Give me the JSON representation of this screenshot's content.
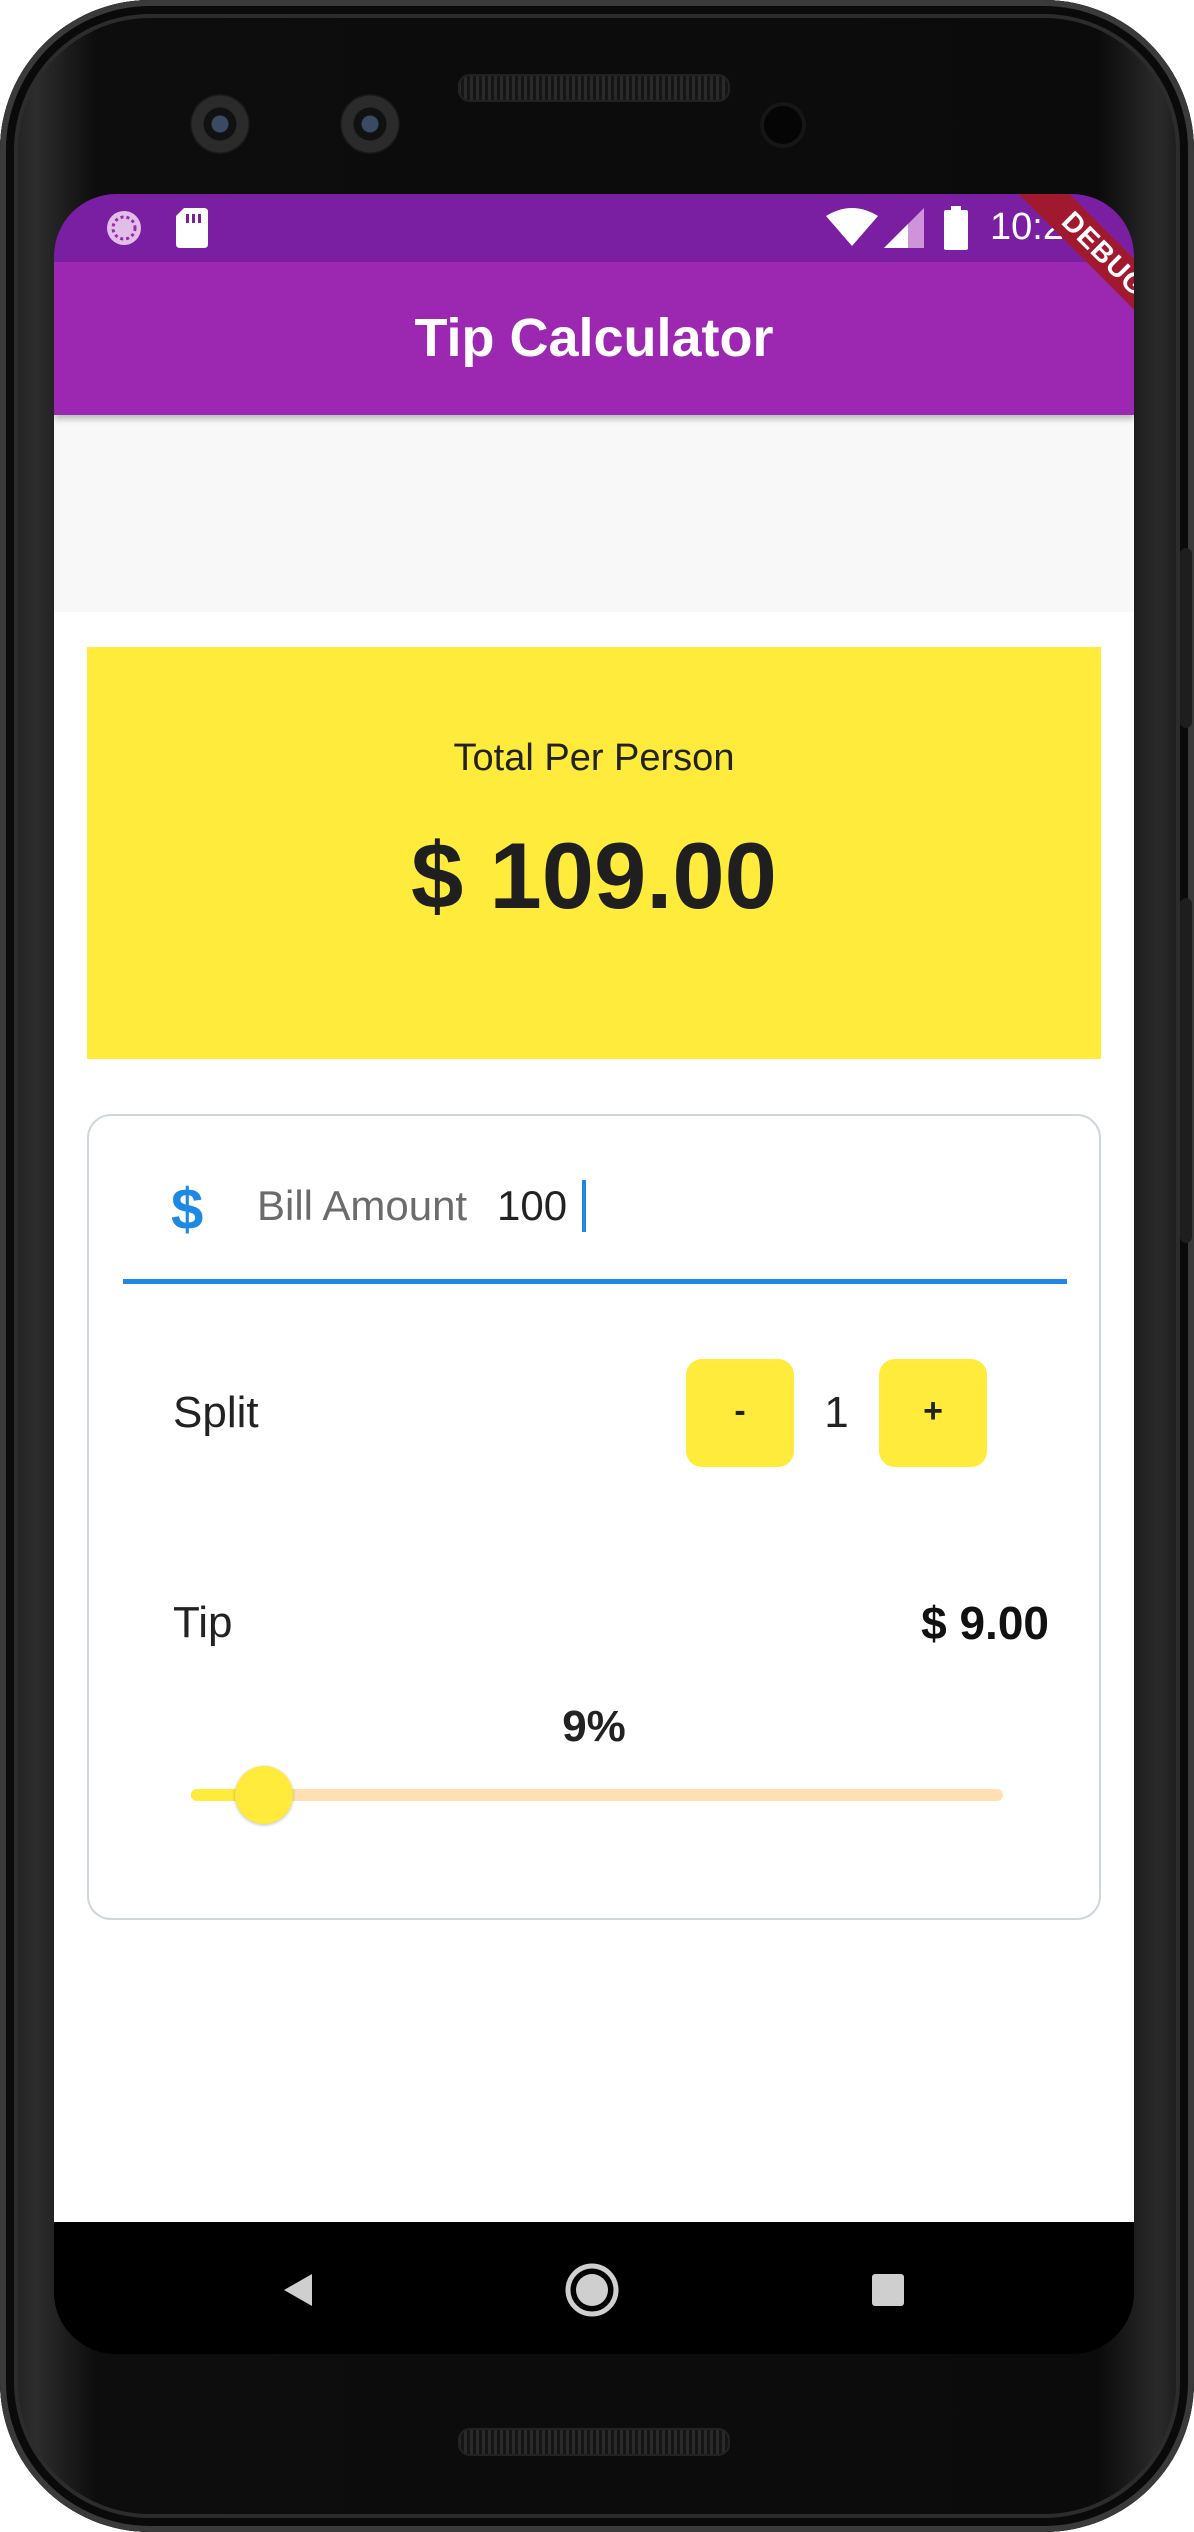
{
  "status_bar": {
    "time": "10:23"
  },
  "debug_banner": "DEBUG",
  "app_bar": {
    "title": "Tip Calculator"
  },
  "total_card": {
    "label": "Total Per Person",
    "value": "$ 109.00"
  },
  "bill": {
    "icon": "$",
    "label": "Bill Amount",
    "value": "100"
  },
  "split": {
    "label": "Split",
    "minus_label": "-",
    "plus_label": "+",
    "count": "1"
  },
  "tip": {
    "label": "Tip",
    "amount": "$ 9.00",
    "percent_label": "9%",
    "slider_fraction": 0.09
  },
  "colors": {
    "app_bar": "#9c27b0",
    "status_bar": "#7b1fa2",
    "card_yellow": "#ffeb3b",
    "accent_blue": "#1e88e5",
    "slider_inactive": "#ffe0b2"
  },
  "icons": [
    "sim-card-icon",
    "sync-icon",
    "wifi-icon",
    "signal-icon",
    "battery-icon",
    "back-icon",
    "home-icon",
    "recents-icon"
  ]
}
